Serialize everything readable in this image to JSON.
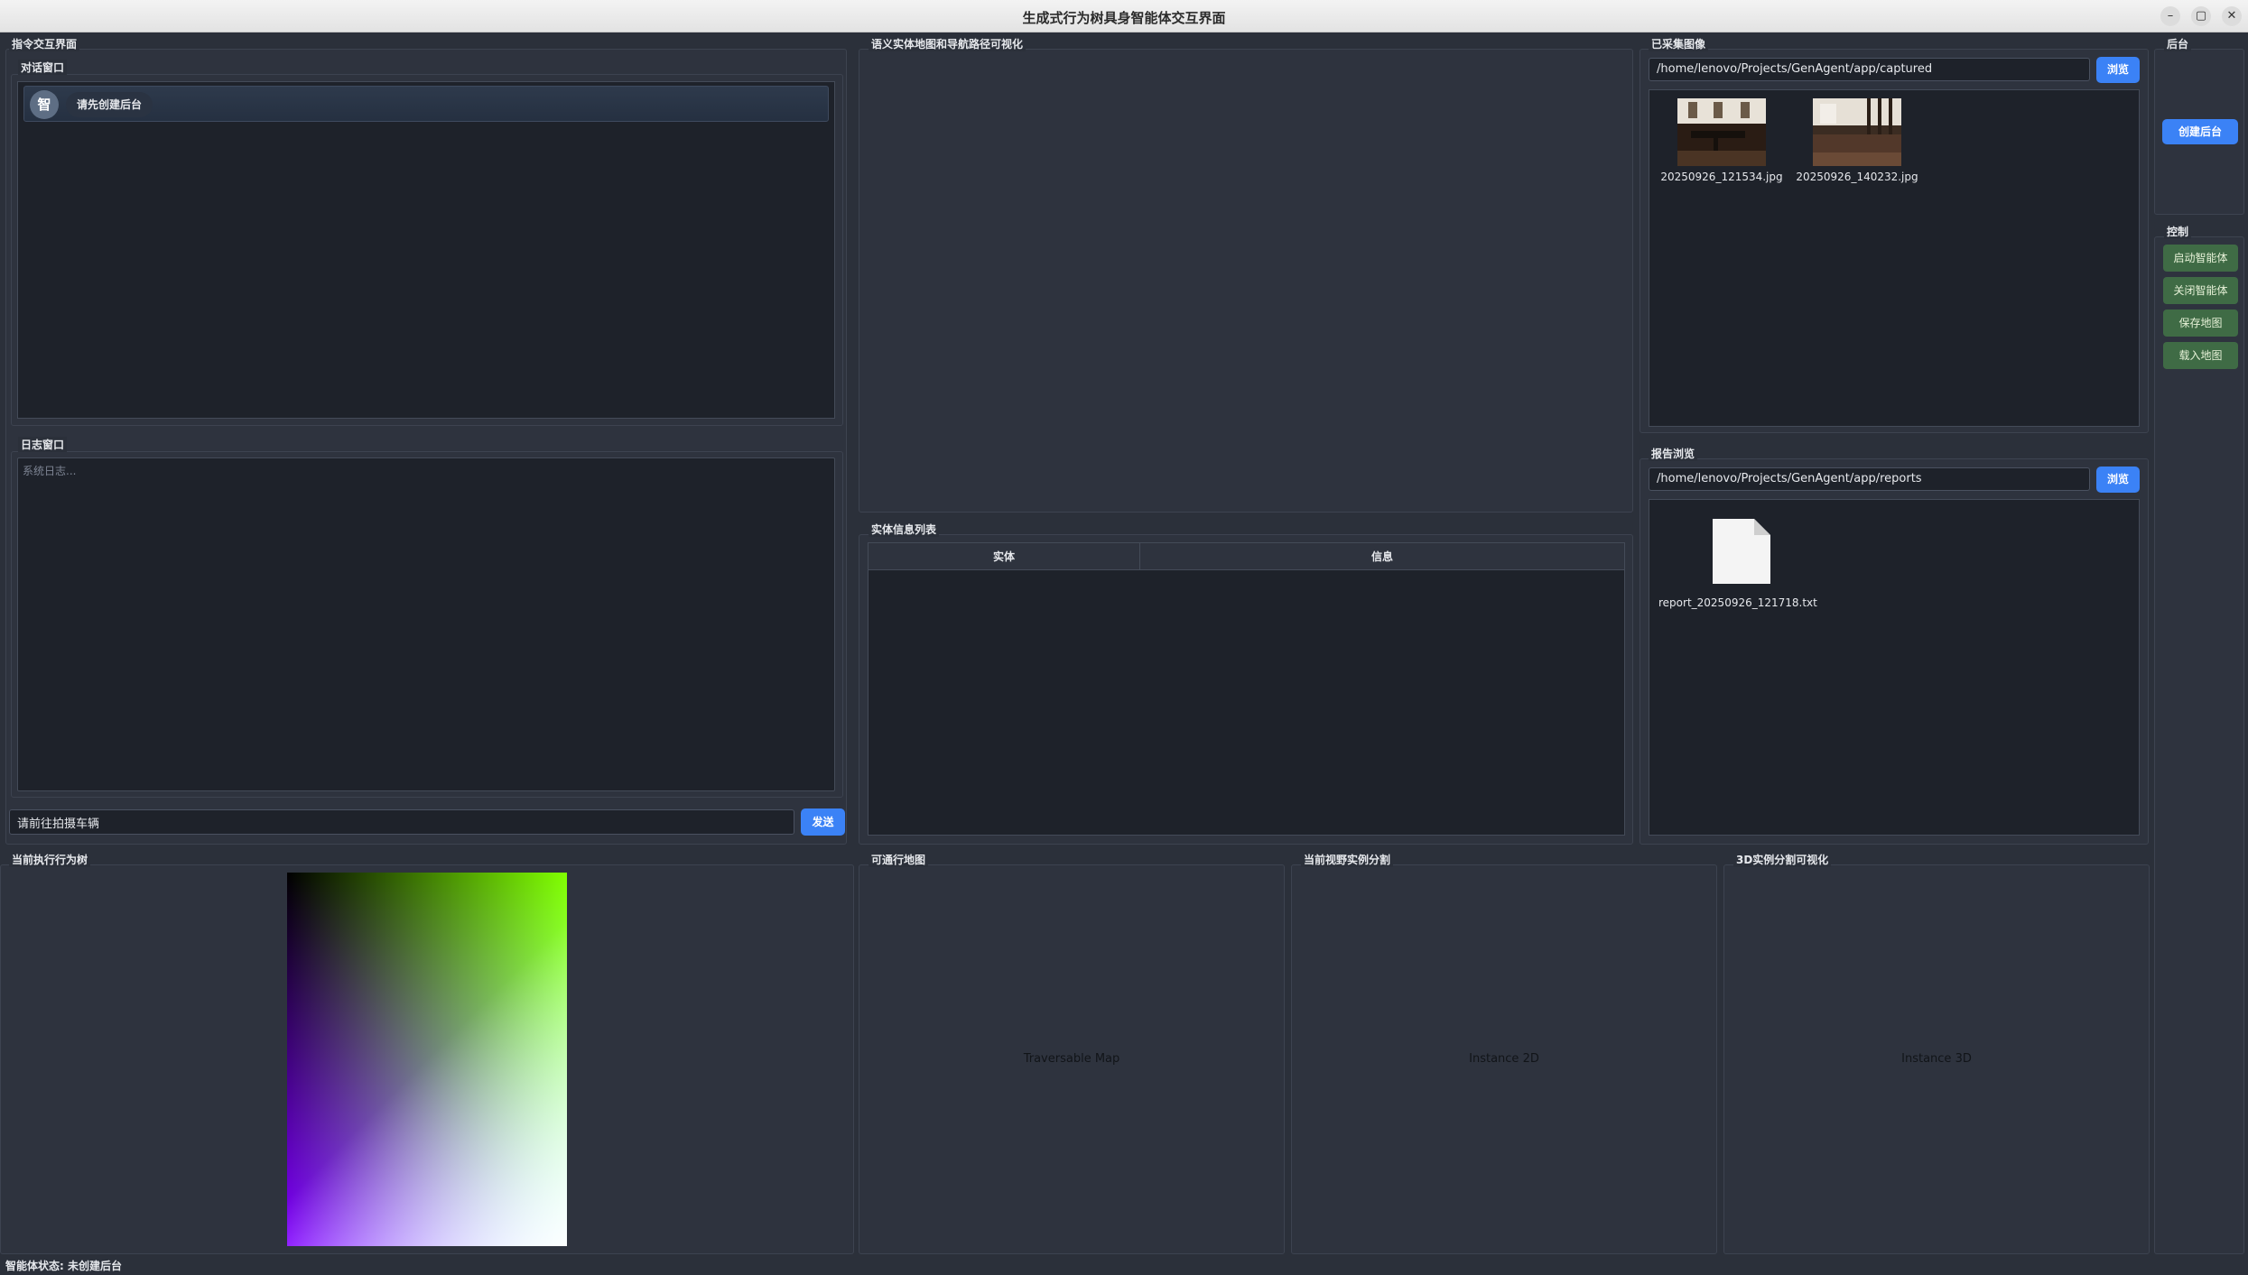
{
  "window": {
    "title": "生成式行为树具身智能体交互界面",
    "minimize": "–",
    "maximize": "▢",
    "close": "✕"
  },
  "instruction": {
    "group_title": "指令交互界面",
    "dialog_title": "对话窗口",
    "chat": {
      "avatar": "智",
      "message": "请先创建后台"
    },
    "log_title": "日志窗口",
    "log_placeholder": "系统日志...",
    "input_value": "请前往拍摄车辆",
    "send_label": "发送"
  },
  "semantic_map": {
    "title": "语义实体地图和导航路径可视化"
  },
  "entity_list": {
    "title": "实体信息列表",
    "columns": [
      "实体",
      "信息"
    ]
  },
  "captured": {
    "title": "已采集图像",
    "path": "/home/lenovo/Projects/GenAgent/app/captured",
    "browse_label": "浏览",
    "images": [
      "20250926_121534.jpg",
      "20250926_140232.jpg"
    ]
  },
  "reports": {
    "title": "报告浏览",
    "path": "/home/lenovo/Projects/GenAgent/app/reports",
    "browse_label": "浏览",
    "files": [
      "report_20250926_121718.txt"
    ]
  },
  "backend": {
    "title": "后台",
    "create_label": "创建后台"
  },
  "control": {
    "title": "控制",
    "buttons": [
      "启动智能体",
      "关闭智能体",
      "保存地图",
      "载入地图"
    ]
  },
  "behavior_tree": {
    "title": "当前执行行为树"
  },
  "traversable": {
    "title": "可通行地图",
    "placeholder": "Traversable Map"
  },
  "instance2d": {
    "title": "当前视野实例分割",
    "placeholder": "Instance 2D"
  },
  "instance3d": {
    "title": "3D实例分割可视化",
    "placeholder": "Instance 3D"
  },
  "status": {
    "text": "智能体状态: 未创建后台"
  },
  "colors": {
    "accent_blue": "#3b82f6",
    "control_green": "#3f6b45",
    "panel_dark": "#1e222a",
    "background": "#2b303a"
  }
}
